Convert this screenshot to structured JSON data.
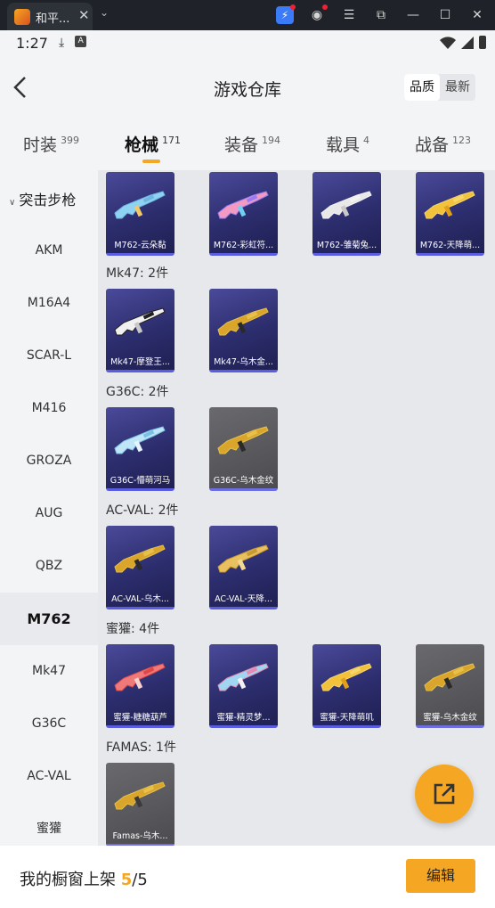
{
  "browser": {
    "tab_title": "和平...",
    "tab_close": "✕",
    "menu_chevron": "⌄"
  },
  "statusbar": {
    "time": "1:27"
  },
  "header": {
    "title": "游戏仓库",
    "sort_options": [
      "品质",
      "最新"
    ]
  },
  "category_tabs": [
    {
      "label": "时装",
      "count": "399"
    },
    {
      "label": "枪械",
      "count": "171"
    },
    {
      "label": "装备",
      "count": "194"
    },
    {
      "label": "载具",
      "count": "4"
    },
    {
      "label": "战备",
      "count": "123"
    }
  ],
  "sidebar": {
    "group": "突击步枪",
    "items": [
      "AKM",
      "M16A4",
      "SCAR-L",
      "M416",
      "GROZA",
      "AUG",
      "QBZ",
      "M762",
      "Mk47",
      "G36C",
      "AC-VAL",
      "蜜獾"
    ],
    "active_index": 7
  },
  "groups": [
    {
      "label": "",
      "items": [
        "M762-云朵黏",
        "M762-彩虹符...",
        "M762-雏菊兔...",
        "M762-天降萌..."
      ]
    },
    {
      "label": "Mk47: 2件",
      "items": [
        "Mk47-摩登王...",
        "Mk47-乌木金..."
      ]
    },
    {
      "label": "G36C: 2件",
      "items": [
        "G36C-懵萌河马",
        "G36C-乌木金纹"
      ]
    },
    {
      "label": "AC-VAL: 2件",
      "items": [
        "AC-VAL-乌木...",
        "AC-VAL-天降..."
      ]
    },
    {
      "label": "蜜獾: 4件",
      "items": [
        "蜜獾-糖糖葫芦",
        "蜜獾-精灵梦...",
        "蜜獾-天降萌叽",
        "蜜獾-乌木金纹"
      ]
    },
    {
      "label": "FAMAS: 1件",
      "items": [
        "Famas-乌木..."
      ]
    }
  ],
  "bottom": {
    "label": "我的橱窗上架",
    "current": "5",
    "total": "/5",
    "edit": "编辑"
  },
  "colors": {
    "accent": "#f5a623",
    "card_purple": "#2c2d6d",
    "card_gray": "#4c4c50"
  }
}
